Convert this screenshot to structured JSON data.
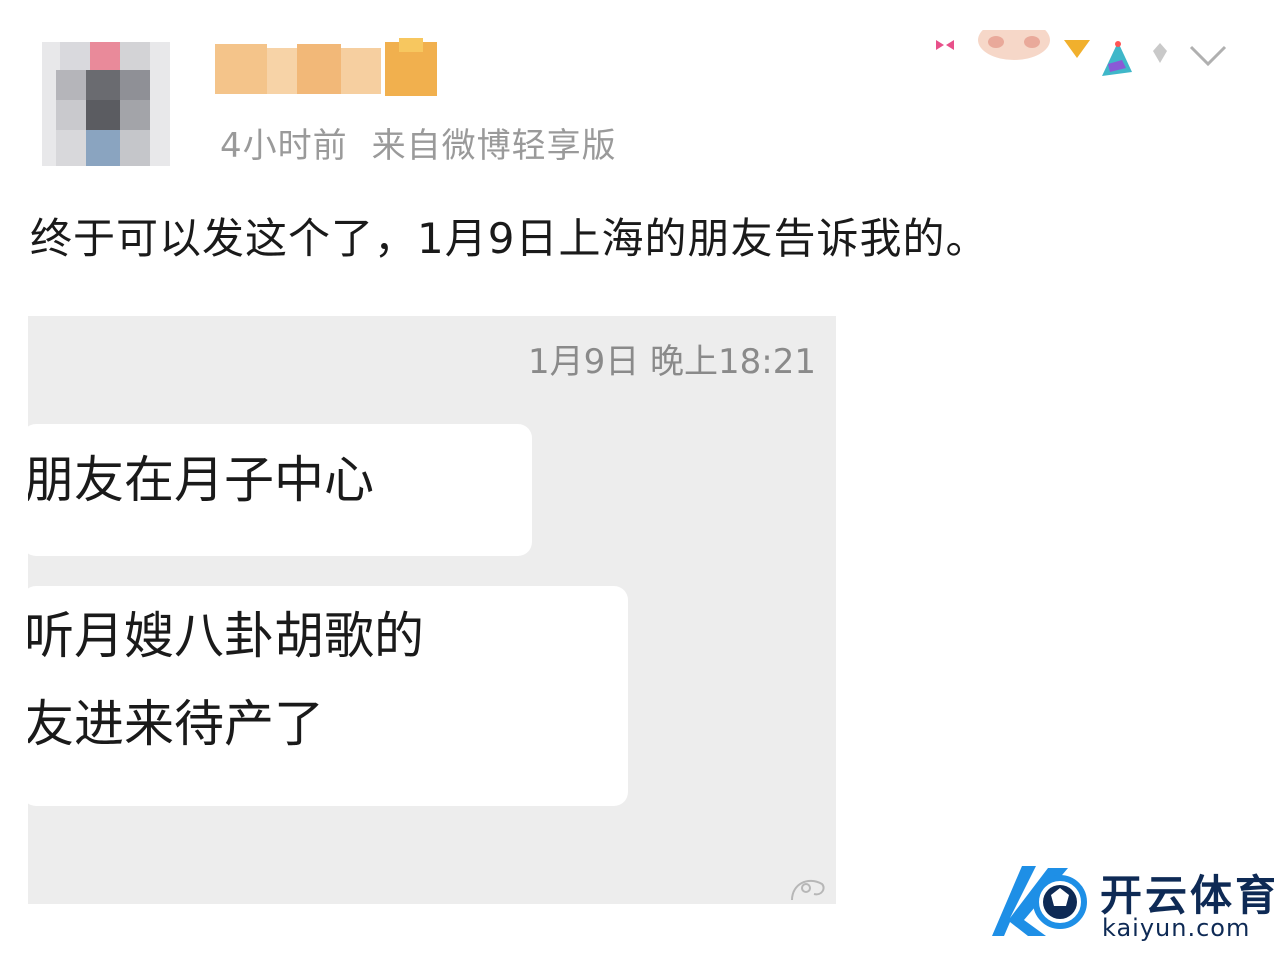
{
  "post": {
    "meta_time": "4小时前",
    "meta_source": "来自微博轻享版",
    "text": "终于可以发这个了，1月9日上海的朋友告诉我的。"
  },
  "chat_screenshot": {
    "timestamp": "1月9日 晚上18:21",
    "messages": [
      {
        "lines": [
          "朋友在月子中心"
        ]
      },
      {
        "lines": [
          "听月嫂八卦胡歌的",
          "友进来待产了"
        ]
      }
    ]
  },
  "watermark": {
    "title": "开云体育",
    "url": "kaiyun.com"
  },
  "colors": {
    "meta_gray": "#9a9a9a",
    "chat_bg": "#ededed",
    "bubble_bg": "#ffffff",
    "logo_blue": "#1e8fe6",
    "logo_navy": "#0e2a55"
  }
}
